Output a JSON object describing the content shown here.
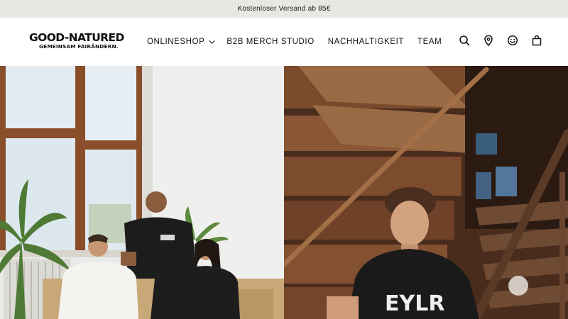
{
  "announcement": "Kostenloser Versand ab 85€",
  "brand": {
    "line1": "GOOD-NATURED",
    "line2": "GEMEINSAM FAIRÄNDERN."
  },
  "nav": [
    {
      "label": "ONLINESHOP",
      "has_dropdown": true
    },
    {
      "label": "B2B MERCH STUDIO"
    },
    {
      "label": "NACHHALTIGKEIT"
    },
    {
      "label": "TEAM"
    }
  ],
  "icons": [
    "search-icon",
    "location-icon",
    "account-icon",
    "cart-icon"
  ],
  "hero": {
    "left_shirt_print": "",
    "right_shirt_print": "EYLR"
  },
  "colors": {
    "announcement_bg": "#e7e8e1",
    "text": "#111111",
    "wood": "#7a4a2c"
  }
}
